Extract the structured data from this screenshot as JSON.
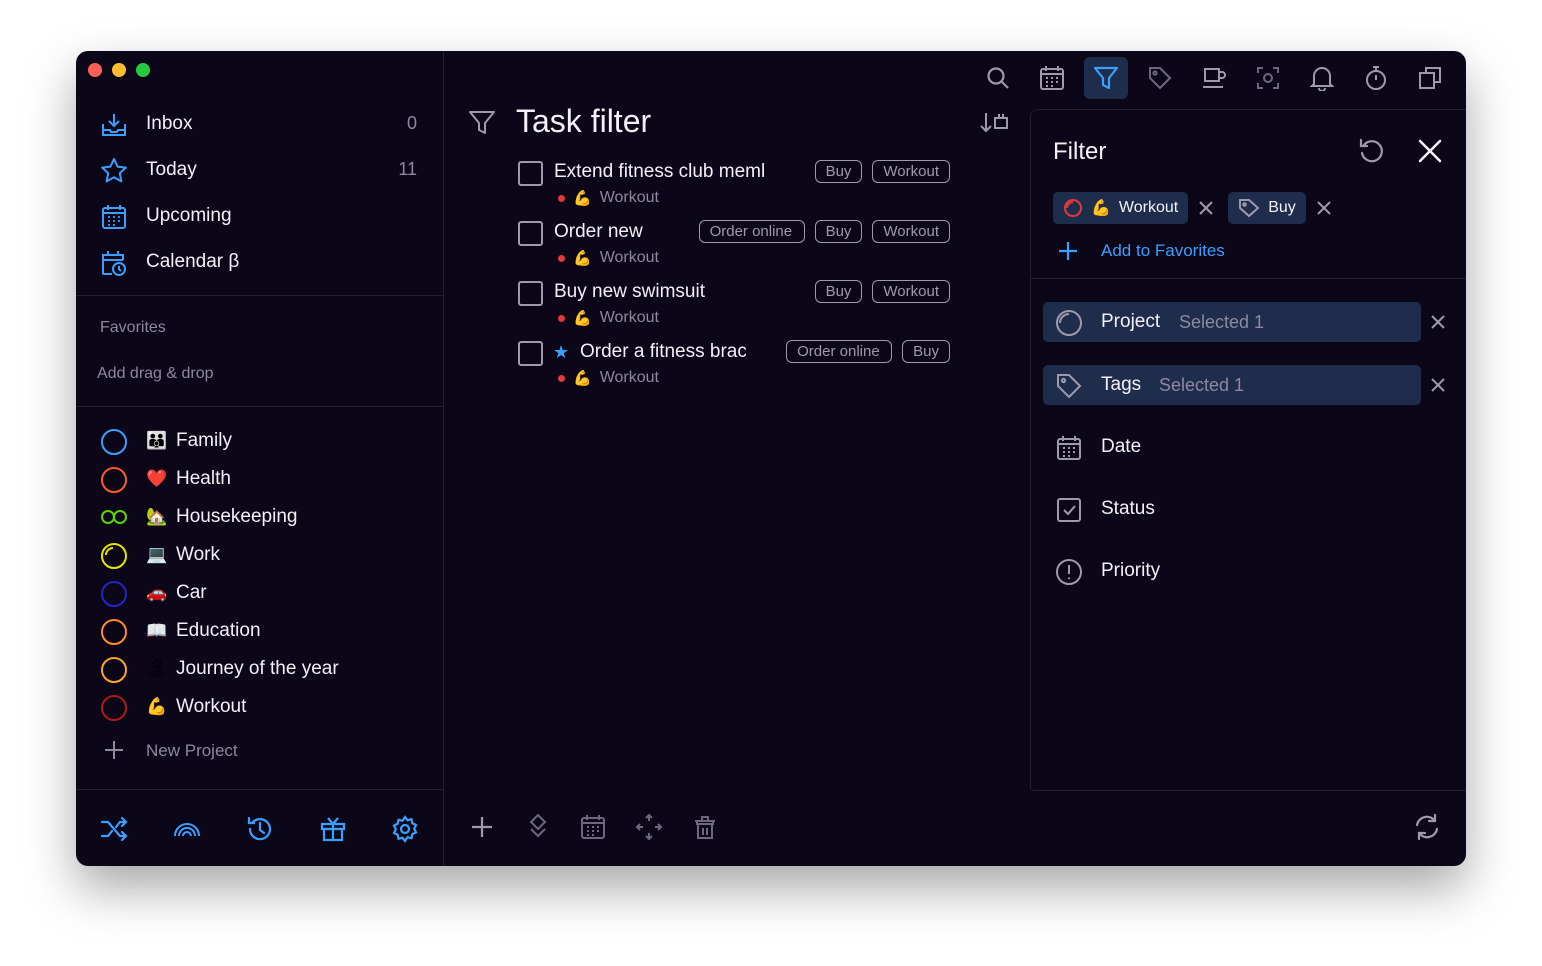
{
  "sidebar": {
    "nav": [
      {
        "label": "Inbox",
        "count": "0",
        "icon": "inbox-icon"
      },
      {
        "label": "Today",
        "count": "11",
        "icon": "star-icon"
      },
      {
        "label": "Upcoming",
        "count": "",
        "icon": "calendar-grid-icon"
      },
      {
        "label": "Calendar β",
        "count": "",
        "icon": "calendar-clock-icon"
      }
    ],
    "favorites_title": "Favorites",
    "favorites_hint": "Add drag & drop",
    "projects": [
      {
        "emoji": "👪",
        "label": "Family",
        "color": "#3aa0ff"
      },
      {
        "emoji": "❤️",
        "label": "Health",
        "color": "#ff5a2c"
      },
      {
        "emoji": "🏡",
        "label": "Housekeeping",
        "color": "#5fd400"
      },
      {
        "emoji": "💻",
        "label": "Work",
        "color": "#e6e600"
      },
      {
        "emoji": "🚗",
        "label": "Car",
        "color": "#2424c8"
      },
      {
        "emoji": "📖",
        "label": "Education",
        "color": "#ff8c2a"
      },
      {
        "emoji": "🏝",
        "label": "Journey of the year",
        "color": "#ffa42a"
      },
      {
        "emoji": "💪",
        "label": "Workout",
        "color": "#b01818"
      }
    ],
    "new_project_label": "New Project",
    "bottom_icons": [
      "shuffle-icon",
      "rainbow-icon",
      "history-icon",
      "gift-icon",
      "settings-icon"
    ]
  },
  "main": {
    "title": "Task filter",
    "tasks": [
      {
        "title": "Extend fitness club membership",
        "starred": false,
        "project_emoji": "💪",
        "project": "Workout",
        "tags": [
          "Buy",
          "Workout"
        ]
      },
      {
        "title": "Order new",
        "starred": false,
        "project_emoji": "💪",
        "project": "Workout",
        "tags": [
          "Order online",
          "Buy",
          "Workout"
        ]
      },
      {
        "title": "Buy new swimsuit",
        "starred": false,
        "project_emoji": "💪",
        "project": "Workout",
        "tags": [
          "Buy",
          "Workout"
        ]
      },
      {
        "title": "Order a fitness bracelet",
        "starred": true,
        "project_emoji": "💪",
        "project": "Workout",
        "tags": [
          "Order online",
          "Buy"
        ]
      }
    ],
    "toolbar_icons": [
      "search-icon",
      "calendar-icon",
      "filter-icon",
      "tag-icon",
      "coffee-icon",
      "focus-icon",
      "bell-icon",
      "stopwatch-icon",
      "copy-icon"
    ],
    "bottom_icons": [
      "add-icon",
      "priority-icon",
      "calendar-icon",
      "move-icon",
      "delete-icon"
    ]
  },
  "filter": {
    "title": "Filter",
    "chips": [
      {
        "emoji": "💪",
        "label": "Workout",
        "kind": "project"
      },
      {
        "label": "Buy",
        "kind": "tag"
      }
    ],
    "add_favorites": "Add to Favorites",
    "criteria": [
      {
        "label": "Project",
        "value": "Selected 1",
        "selected": true
      },
      {
        "label": "Tags",
        "value": "Selected 1",
        "selected": true
      },
      {
        "label": "Date",
        "value": "",
        "selected": false
      },
      {
        "label": "Status",
        "value": "",
        "selected": false
      },
      {
        "label": "Priority",
        "value": "",
        "selected": false
      }
    ]
  },
  "colors": {
    "accent": "#3aa0ff",
    "background": "#0b0618",
    "selected": "#1f2d4d"
  }
}
